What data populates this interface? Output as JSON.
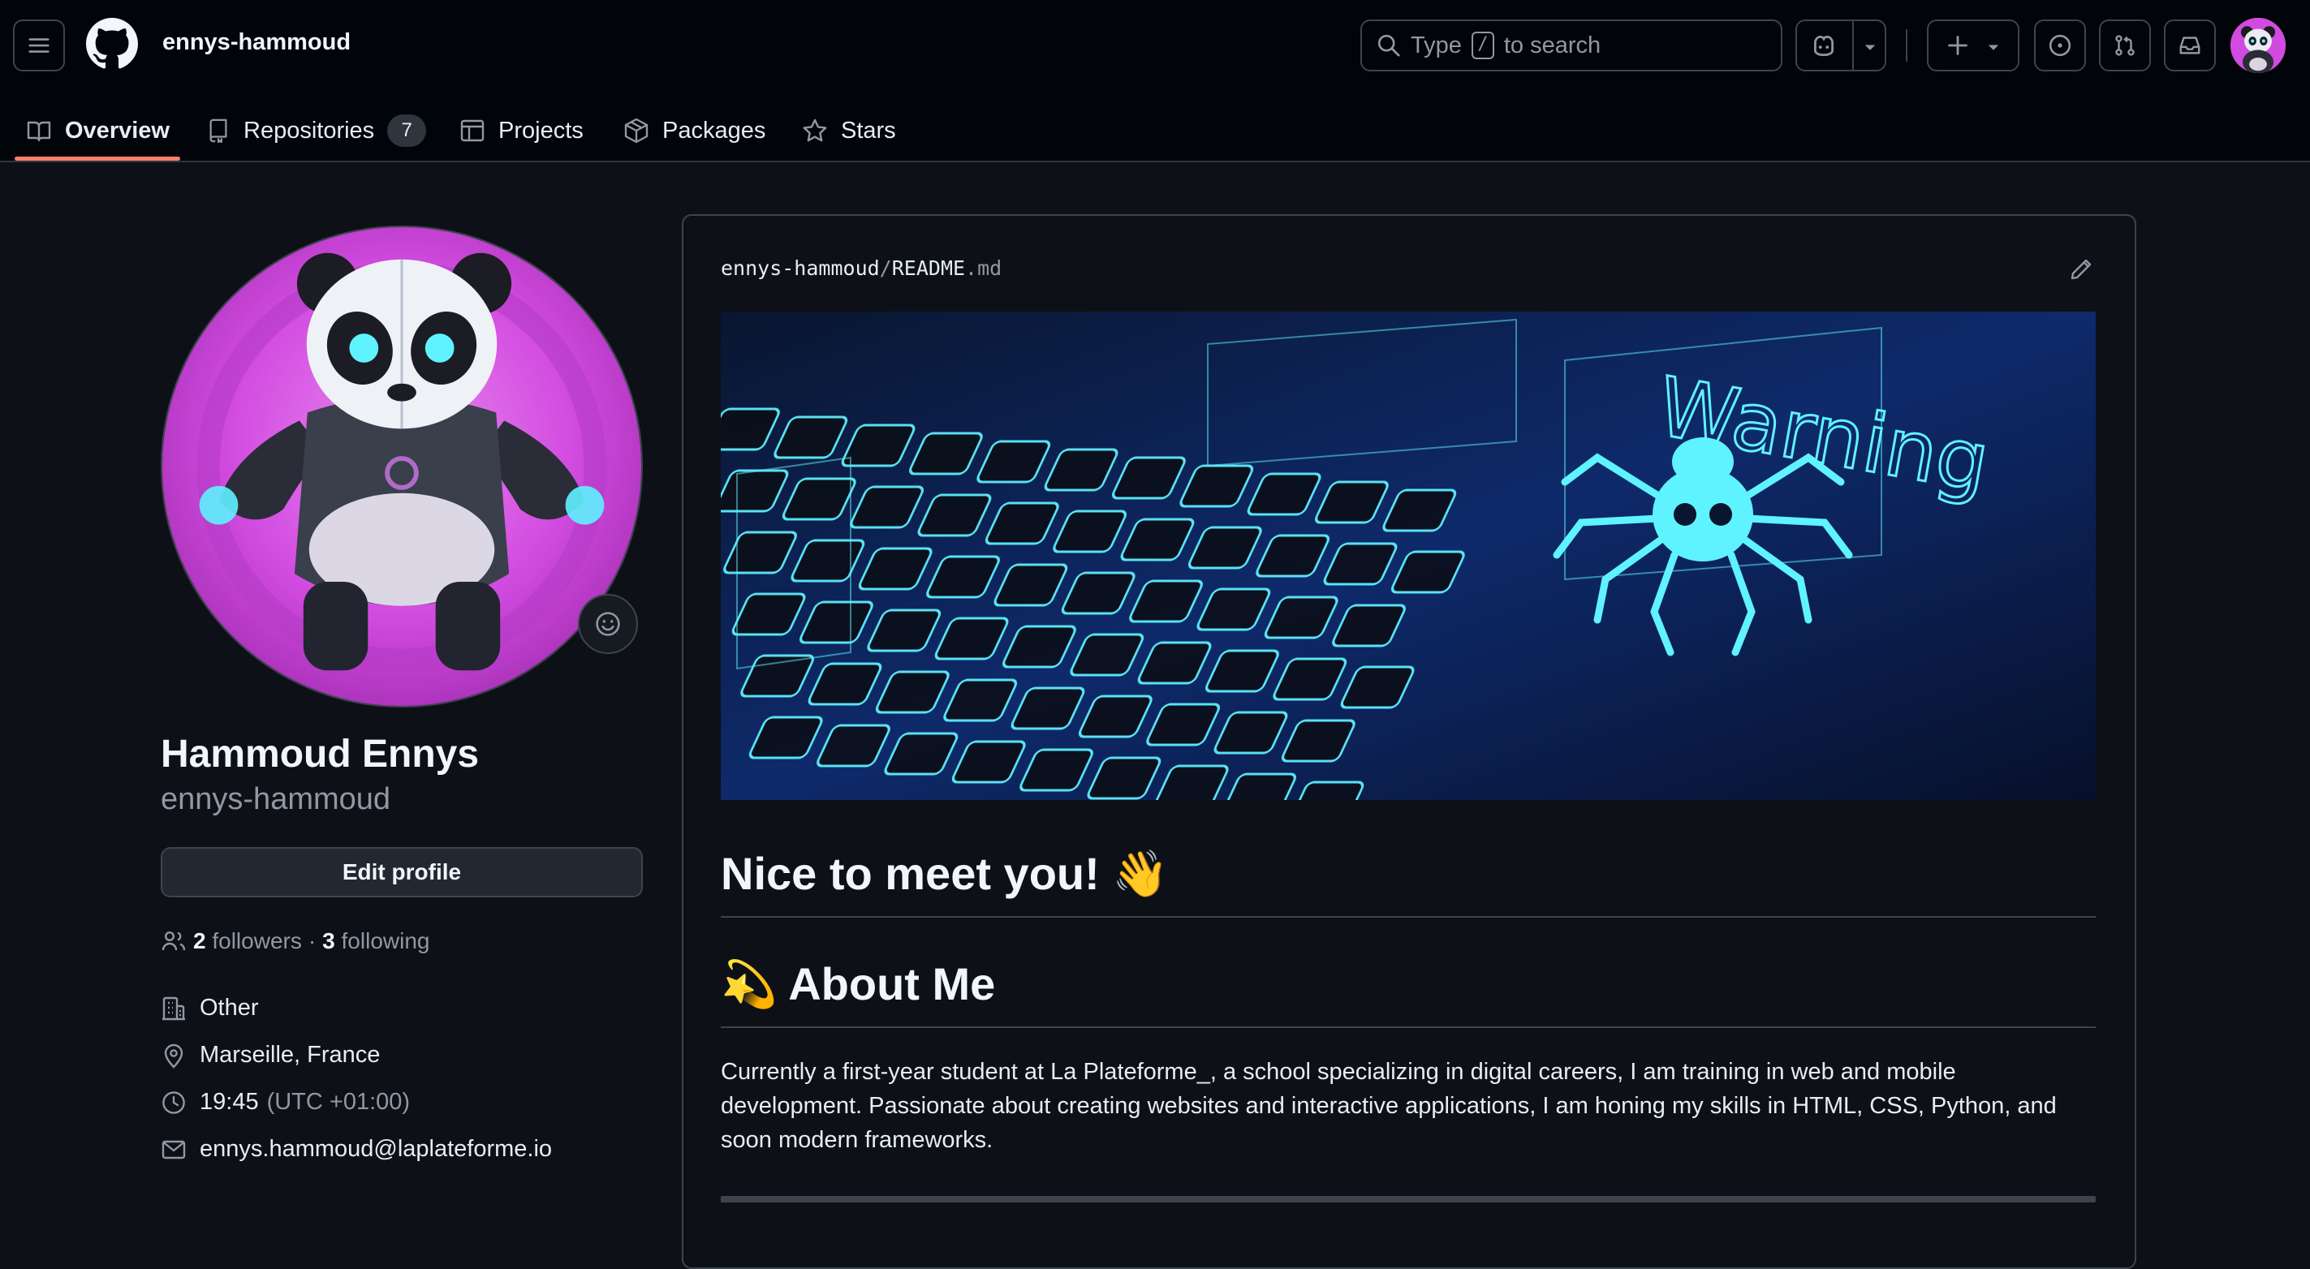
{
  "header": {
    "username": "ennys-hammoud",
    "search_prefix": "Type",
    "search_key": "/",
    "search_suffix": "to search"
  },
  "tabs": [
    {
      "label": "Overview",
      "icon": "book-icon",
      "active": true
    },
    {
      "label": "Repositories",
      "icon": "repo-icon",
      "count": "7"
    },
    {
      "label": "Projects",
      "icon": "table-icon"
    },
    {
      "label": "Packages",
      "icon": "package-icon"
    },
    {
      "label": "Stars",
      "icon": "star-icon"
    }
  ],
  "profile": {
    "full_name": "Hammoud Ennys",
    "login": "ennys-hammoud",
    "edit_label": "Edit profile",
    "followers_count": "2",
    "followers_label": "followers",
    "separator": "·",
    "following_count": "3",
    "following_label": "following",
    "company": "Other",
    "location": "Marseille, France",
    "time": "19:45",
    "timezone": "(UTC +01:00)",
    "email": "ennys.hammoud@laplateforme.io"
  },
  "readme": {
    "owner": "ennys-hammoud",
    "path_sep": "/",
    "file_base": "README",
    "file_ext": ".md",
    "banner_word": "Warning",
    "heading1": "Nice to meet you! 👋",
    "heading2": "💫 About Me",
    "paragraph": "Currently a first-year student at La Plateforme_, a school specializing in digital careers, I am training in web and mobile development. Passionate about creating websites and interactive applications, I am honing my skills in HTML, CSS, Python, and soon modern frameworks."
  },
  "colors": {
    "background": "#0d1117",
    "header_bg": "#010409",
    "accent_underline": "#f78166",
    "border": "#3d444d",
    "avatar_pink": "#d24be0",
    "banner_cyan": "#5ff2ff"
  }
}
